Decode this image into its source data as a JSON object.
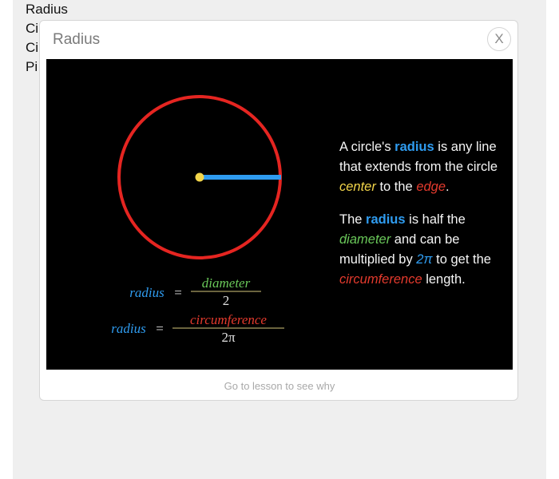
{
  "background_list": {
    "items": [
      "Radius",
      "Ci",
      "Ci",
      "Pi"
    ]
  },
  "modal": {
    "title": "Radius",
    "close_label": "X",
    "footer_link": "Go to lesson to see why"
  },
  "diagram": {
    "formula1": {
      "lhs": "radius",
      "eq": "=",
      "numerator": "diameter",
      "denominator": "2"
    },
    "formula2": {
      "lhs": "radius",
      "eq": "=",
      "numerator": "circumference",
      "denominator": "2π"
    }
  },
  "explanation": {
    "p1": {
      "t1": "A circle's ",
      "k1": "radius",
      "t2": " is any line that extends from the circle ",
      "k2": "center",
      "t3": " to the ",
      "k3": "edge",
      "t4": "."
    },
    "p2": {
      "t1": "The ",
      "k1": "radius",
      "t2": " is half the ",
      "k2": "diameter",
      "t3": " and can be multiplied by ",
      "k3": "2π",
      "t4": " to get the ",
      "k4": "circumference",
      "t5": " length."
    }
  },
  "colors": {
    "radius": "#2f9cf0",
    "diameter": "#6ac95a",
    "center": "#f2d54a",
    "edge": "#e43a2d",
    "panel_background": "#000000"
  }
}
